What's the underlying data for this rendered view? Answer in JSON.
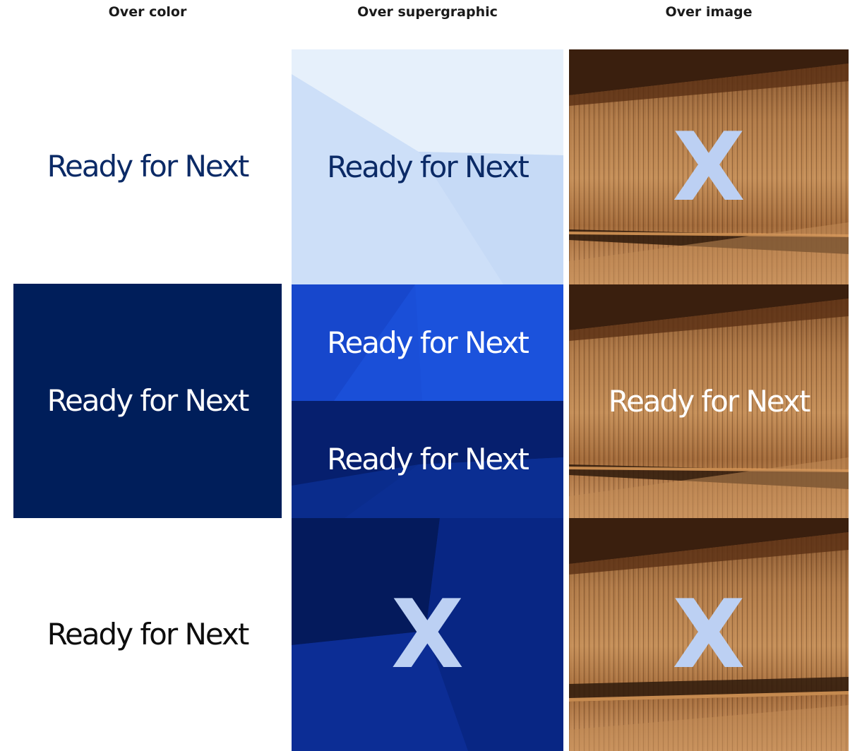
{
  "headers": {
    "color": "Over color",
    "supergraphic": "Over supergraphic",
    "image": "Over image"
  },
  "tagline": "Ready for Next",
  "x_mark": "X",
  "colors": {
    "navy": "#001e5a",
    "dark_navy": "#021a54",
    "light_blue": "#cddff8",
    "lightest_blue": "#e6f0fb",
    "bright_blue": "#1a4fd8",
    "mid_blue": "#0a2c8c",
    "x_tint": "#bcd0f3",
    "black": "#0d0d0d",
    "white": "#ffffff"
  }
}
